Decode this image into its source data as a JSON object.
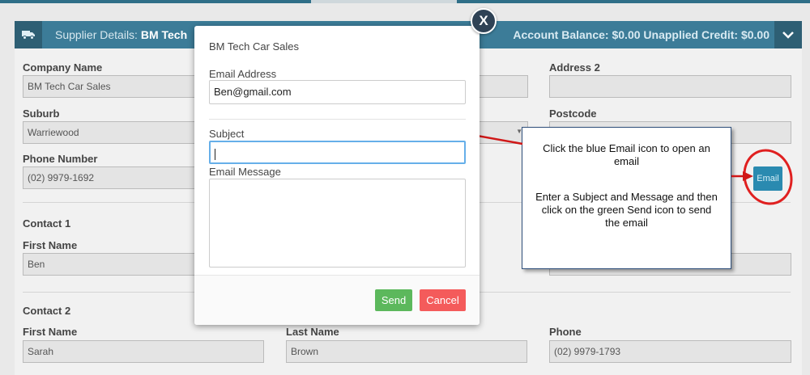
{
  "header": {
    "title_prefix": "Supplier Details: ",
    "title_name": "BM Tech",
    "balance": "Account Balance: $0.00  Unapplied Credit: $0.00"
  },
  "form": {
    "company_name_label": "Company Name",
    "company_name_value": "BM Tech Car Sales",
    "address2_label": "Address 2",
    "address2_value": "",
    "suburb_label": "Suburb",
    "suburb_value": "Warriewood",
    "postcode_label": "Postcode",
    "postcode_value": "",
    "phone_label": "Phone Number",
    "phone_value": "(02) 9979-1692",
    "email_button": "Email",
    "contact1_heading": "Contact 1",
    "contact1_first_label": "First Name",
    "contact1_first_value": "Ben",
    "contact2_heading": "Contact 2",
    "contact2_first_label": "First Name",
    "contact2_first_value": "Sarah",
    "contact2_last_label": "Last Name",
    "contact2_last_value": "Brown",
    "contact2_phone_label": "Phone",
    "contact2_phone_value": "(02) 9979-1793"
  },
  "modal": {
    "title": "BM Tech Car Sales",
    "email_label": "Email Address",
    "email_value": "Ben@gmail.com",
    "subject_label": "Subject",
    "subject_value": "",
    "message_label": "Email Message",
    "message_value": "",
    "send_label": "Send",
    "cancel_label": "Cancel",
    "close_label": "X"
  },
  "callout": {
    "line1": "Click the blue Email icon to open an email",
    "line2": "Enter a Subject and Message and then click on the green Send icon to send the email"
  },
  "colors": {
    "header": "#3c7c98",
    "send": "#5cb85c",
    "cancel": "#f45b5b",
    "email_button": "#2a8ab0",
    "annotation": "#e02020"
  }
}
